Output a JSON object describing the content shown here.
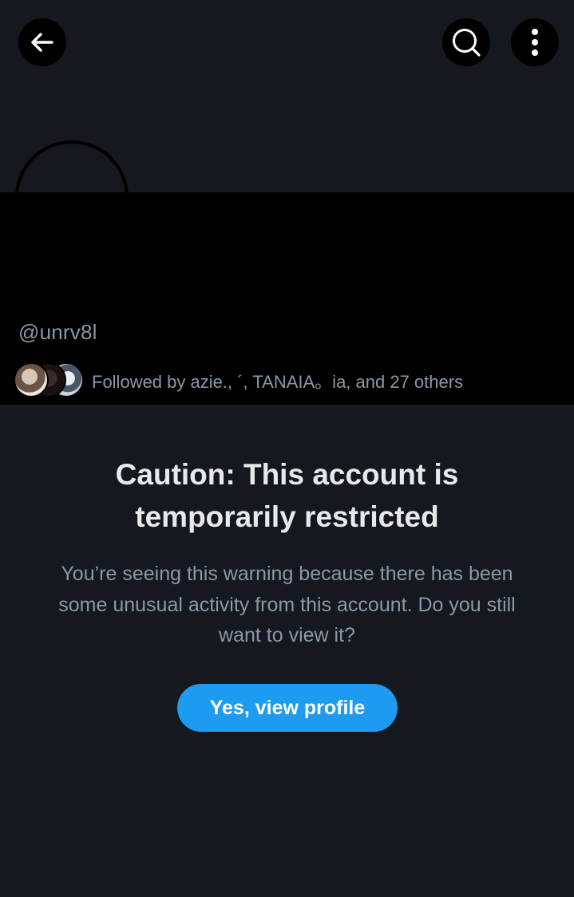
{
  "header": {
    "back_icon": "arrow-left-icon",
    "search_icon": "search-icon",
    "more_icon": "more-vertical-icon"
  },
  "profile": {
    "handle": "@unrv8l",
    "followed_by": "Followed by azie., ´, TANAIA。ia, and 27 others"
  },
  "warning": {
    "title": "Caution: This account is temporarily restricted",
    "body": "You’re seeing this warning because there has been some unusual activity from this account. Do you still want to view it?",
    "button_label": "Yes, view profile"
  },
  "colors": {
    "background": "#15181e",
    "accent": "#1d9bf0",
    "secondary_text": "#8b98a5",
    "primary_text": "#e7e9ea"
  }
}
